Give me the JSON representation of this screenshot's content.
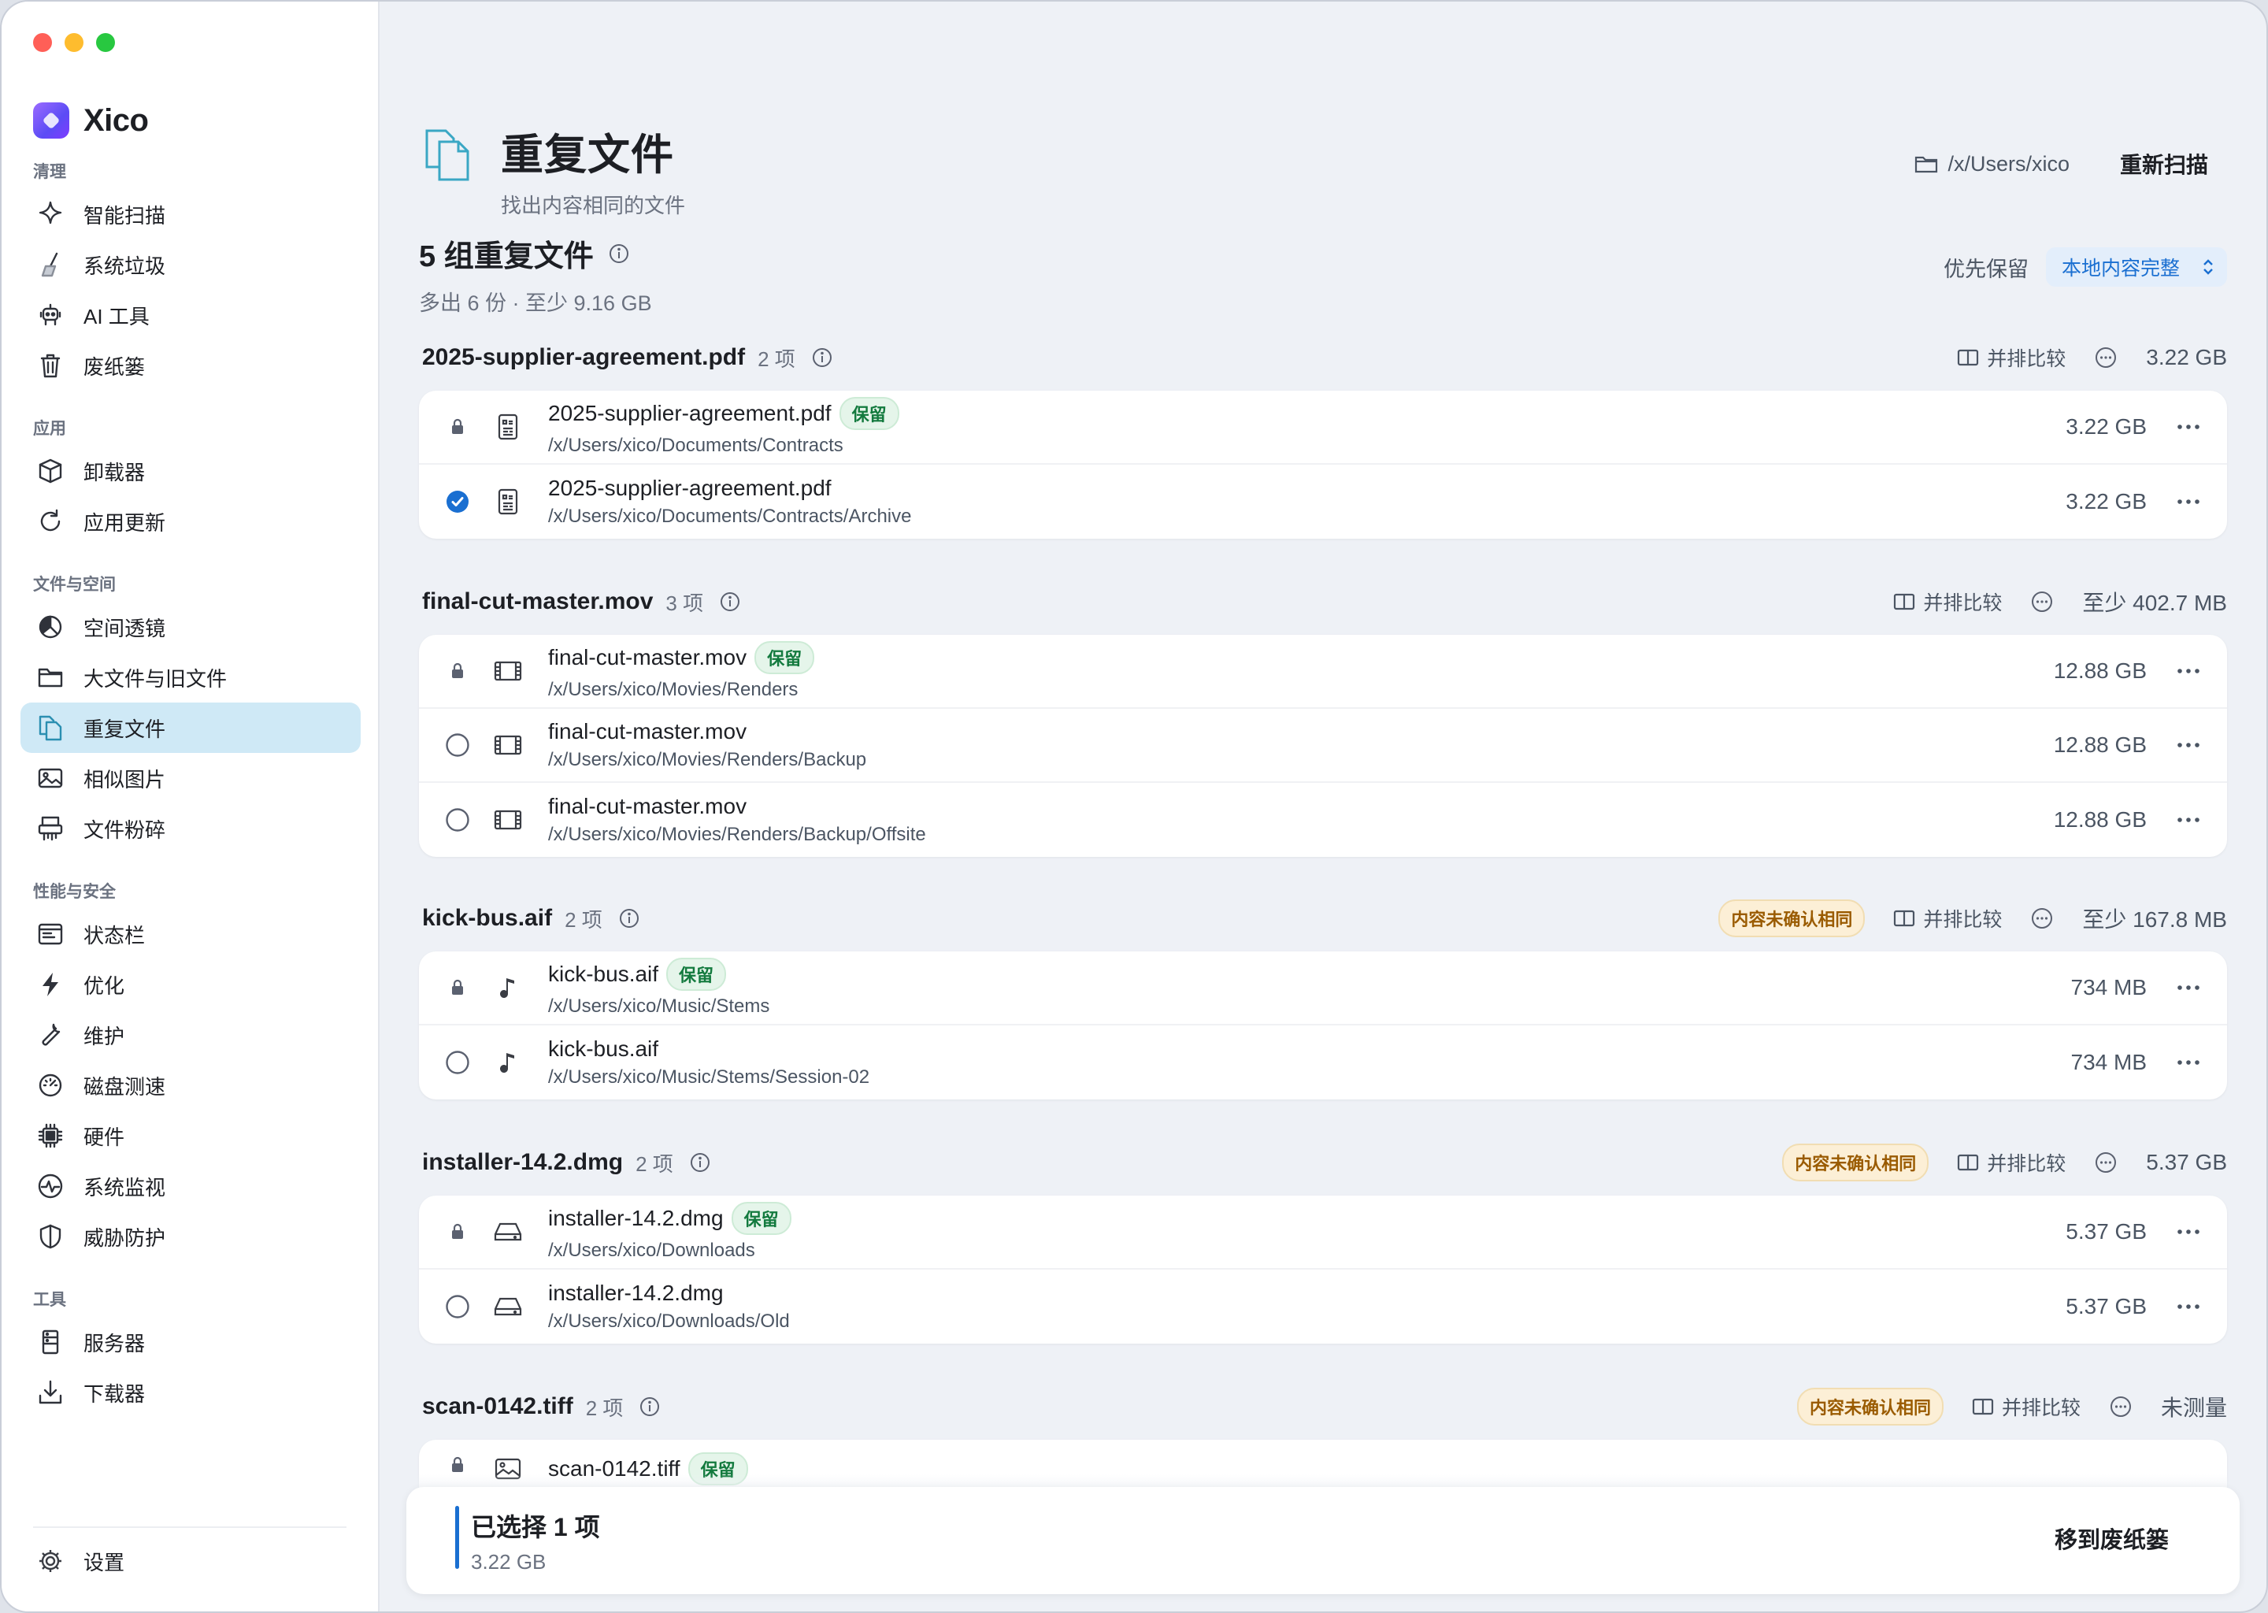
{
  "app": {
    "name": "Xico"
  },
  "colors": {
    "accent": "#1a6fd1",
    "active_nav": "#cfe9f6",
    "keep": "#137a3e",
    "warn": "#9a5b00"
  },
  "sidebar": {
    "sections": [
      {
        "title": "清理",
        "items": [
          {
            "label": "智能扫描",
            "icon": "sparkle-icon"
          },
          {
            "label": "系统垃圾",
            "icon": "broom-icon"
          },
          {
            "label": "AI 工具",
            "icon": "robot-icon"
          },
          {
            "label": "废纸篓",
            "icon": "trash-icon"
          }
        ]
      },
      {
        "title": "应用",
        "items": [
          {
            "label": "卸载器",
            "icon": "box-icon"
          },
          {
            "label": "应用更新",
            "icon": "refresh-icon"
          }
        ]
      },
      {
        "title": "文件与空间",
        "items": [
          {
            "label": "空间透镜",
            "icon": "pie-icon"
          },
          {
            "label": "大文件与旧文件",
            "icon": "folder-icon"
          },
          {
            "label": "重复文件",
            "icon": "duplicate-icon",
            "active": true
          },
          {
            "label": "相似图片",
            "icon": "image-icon"
          },
          {
            "label": "文件粉碎",
            "icon": "shredder-icon"
          }
        ]
      },
      {
        "title": "性能与安全",
        "items": [
          {
            "label": "状态栏",
            "icon": "menubar-icon"
          },
          {
            "label": "优化",
            "icon": "bolt-icon"
          },
          {
            "label": "维护",
            "icon": "wrench-icon"
          },
          {
            "label": "磁盘测速",
            "icon": "gauge-icon"
          },
          {
            "label": "硬件",
            "icon": "chip-icon"
          },
          {
            "label": "系统监视",
            "icon": "pulse-icon"
          },
          {
            "label": "威胁防护",
            "icon": "shield-icon"
          }
        ]
      },
      {
        "title": "工具",
        "items": [
          {
            "label": "服务器",
            "icon": "server-icon"
          },
          {
            "label": "下载器",
            "icon": "download-icon"
          }
        ]
      }
    ],
    "settings_label": "设置"
  },
  "header": {
    "title": "重复文件",
    "subtitle": "找出内容相同的文件",
    "path": "/x/Users/xico",
    "rescan_label": "重新扫描"
  },
  "summary": {
    "title": "5 组重复文件",
    "subtitle": "多出 6 份 · 至少 9.16 GB",
    "prefer_label": "优先保留",
    "prefer_value": "本地内容完整"
  },
  "labels": {
    "compare": "并排比较",
    "keep": "保留"
  },
  "groups": [
    {
      "name": "2025-supplier-agreement.pdf",
      "count": "2 项",
      "size": "3.22 GB",
      "warn": "",
      "type": "doc",
      "files": [
        {
          "name": "2025-supplier-agreement.pdf",
          "path": "/x/Users/xico/Documents/Contracts",
          "size": "3.22 GB",
          "state": "locked",
          "keep": true
        },
        {
          "name": "2025-supplier-agreement.pdf",
          "path": "/x/Users/xico/Documents/Contracts/Archive",
          "size": "3.22 GB",
          "state": "checked",
          "keep": false
        }
      ]
    },
    {
      "name": "final-cut-master.mov",
      "count": "3 项",
      "size": "至少 402.7 MB",
      "warn": "",
      "type": "film",
      "files": [
        {
          "name": "final-cut-master.mov",
          "path": "/x/Users/xico/Movies/Renders",
          "size": "12.88 GB",
          "state": "locked",
          "keep": true
        },
        {
          "name": "final-cut-master.mov",
          "path": "/x/Users/xico/Movies/Renders/Backup",
          "size": "12.88 GB",
          "state": "unchecked",
          "keep": false
        },
        {
          "name": "final-cut-master.mov",
          "path": "/x/Users/xico/Movies/Renders/Backup/Offsite",
          "size": "12.88 GB",
          "state": "unchecked",
          "keep": false
        }
      ]
    },
    {
      "name": "kick-bus.aif",
      "count": "2 项",
      "size": "至少 167.8 MB",
      "warn": "内容未确认相同",
      "type": "music",
      "files": [
        {
          "name": "kick-bus.aif",
          "path": "/x/Users/xico/Music/Stems",
          "size": "734 MB",
          "state": "locked",
          "keep": true
        },
        {
          "name": "kick-bus.aif",
          "path": "/x/Users/xico/Music/Stems/Session-02",
          "size": "734 MB",
          "state": "unchecked",
          "keep": false
        }
      ]
    },
    {
      "name": "installer-14.2.dmg",
      "count": "2 项",
      "size": "5.37 GB",
      "warn": "内容未确认相同",
      "type": "disk",
      "files": [
        {
          "name": "installer-14.2.dmg",
          "path": "/x/Users/xico/Downloads",
          "size": "5.37 GB",
          "state": "locked",
          "keep": true
        },
        {
          "name": "installer-14.2.dmg",
          "path": "/x/Users/xico/Downloads/Old",
          "size": "5.37 GB",
          "state": "unchecked",
          "keep": false
        }
      ]
    },
    {
      "name": "scan-0142.tiff",
      "count": "2 项",
      "size": "未测量",
      "warn": "内容未确认相同",
      "type": "image",
      "files": [
        {
          "name": "scan-0142.tiff",
          "path": "",
          "size": "",
          "state": "locked",
          "keep": true
        }
      ]
    }
  ],
  "bottom": {
    "title": "已选择 1 项",
    "size": "3.22 GB",
    "trash_label": "移到废纸篓"
  }
}
